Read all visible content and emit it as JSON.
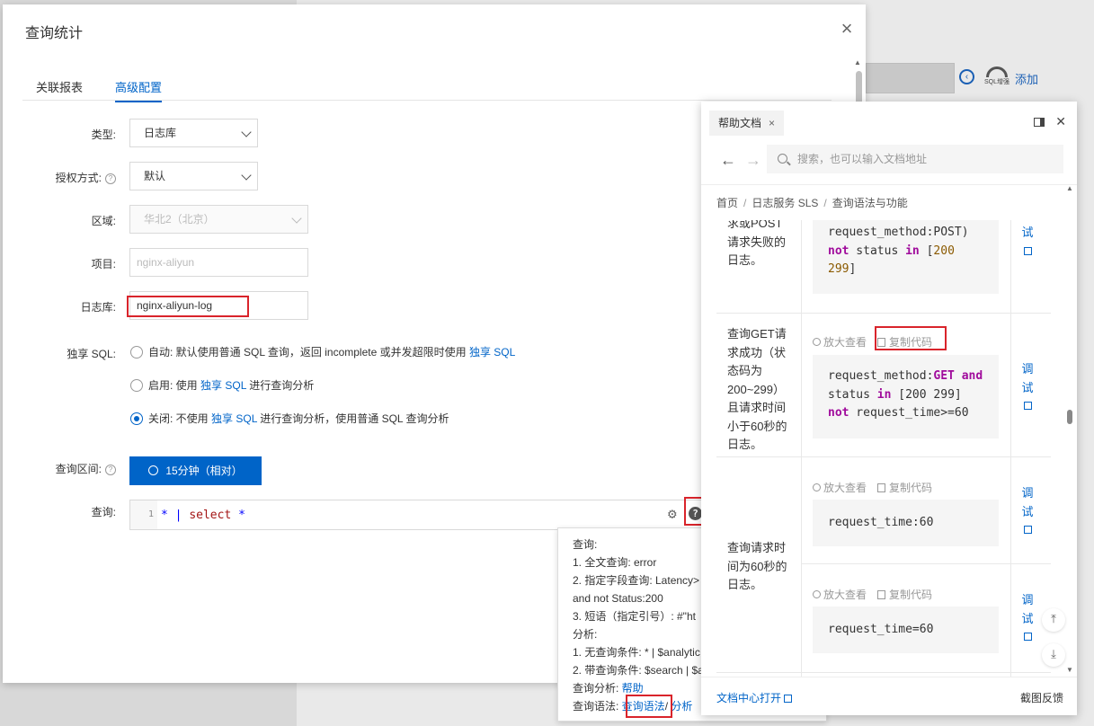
{
  "background": {
    "add_label": "添加",
    "sql_badge": "SQL增强"
  },
  "dialog": {
    "title": "查询统计",
    "close": "×",
    "tabs": [
      "关联报表",
      "高级配置"
    ],
    "active_tab": 1
  },
  "form": {
    "type_label": "类型:",
    "type_value": "日志库",
    "auth_label": "授权方式:",
    "auth_value": "默认",
    "region_label": "区域:",
    "region_value": "华北2（北京）",
    "project_label": "项目:",
    "project_value": "nginx-aliyun",
    "logstore_label": "日志库:",
    "logstore_value": "nginx-aliyun-log",
    "exclusive_label": "独享 SQL:",
    "radio_options": [
      {
        "prefix": "自动: 默认使用普通 SQL 查询，返回 incomplete 或并发超限时使用 ",
        "link": "独享 SQL",
        "suffix": "",
        "checked": false
      },
      {
        "prefix": "启用: 使用 ",
        "link": "独享 SQL",
        "suffix": " 进行查询分析",
        "checked": false
      },
      {
        "prefix": "关闭: 不使用 ",
        "link": "独享 SQL",
        "suffix": " 进行查询分析，使用普通 SQL 查询分析",
        "checked": true
      }
    ],
    "range_label": "查询区间:",
    "range_button": "15分钟（相对）",
    "query_label": "查询:",
    "line_number": "1",
    "query_star": "*",
    "query_pipe": "|",
    "query_select": "select",
    "query_star2": "*"
  },
  "tooltip": {
    "lines": [
      "查询:",
      "1. 全文查询: error",
      "2. 指定字段查询: Latency>",
      "and not Status:200",
      "3. 短语（指定引号）: #\"ht",
      "分析:",
      "1. 无查询条件: * | $analytic",
      "2. 带查询条件: $search | $a"
    ],
    "analysis_label": "查询分析: ",
    "analysis_link": "帮助",
    "syntax_label": "查询语法: ",
    "syntax_link": "查询语法",
    "syntax_sep": "/",
    "syntax_link2": "分析"
  },
  "help_panel": {
    "tab_label": "帮助文档",
    "search_placeholder": "搜索，也可以输入文档地址",
    "breadcrumb": [
      "首页",
      "日志服务 SLS",
      "查询语法与功能"
    ],
    "footer_open": "文档中心打开",
    "footer_feedback": "截图反馈",
    "zoom_label": "放大查看",
    "copy_label": "复制代码",
    "debug_label": [
      "调",
      "试"
    ],
    "rows": [
      {
        "desc": [
          "求或POST",
          "请求失败的",
          "日志。"
        ]
      },
      {
        "desc": [
          "查询GET请",
          "求成功（状",
          "态码为",
          "200~299）",
          "且请求时间",
          "小于60秒的",
          "日志。"
        ]
      },
      {
        "desc": [
          "查询请求时",
          "间为60秒的",
          "日志。"
        ]
      }
    ],
    "code1": {
      "line1": "request_method:POST)",
      "not": "not",
      "mid": " status ",
      "in": "in",
      "bracket": " [",
      "n1": "200",
      "n2": "299",
      "close": "]"
    },
    "code2": {
      "a": "request_method:",
      "get": "GET",
      "and": "and",
      "status": "status ",
      "in": "in",
      "br": " [200 299]",
      "not": "not",
      "rest": " request_time>=60"
    },
    "code3": "request_time:60",
    "code4": "request_time=60"
  }
}
